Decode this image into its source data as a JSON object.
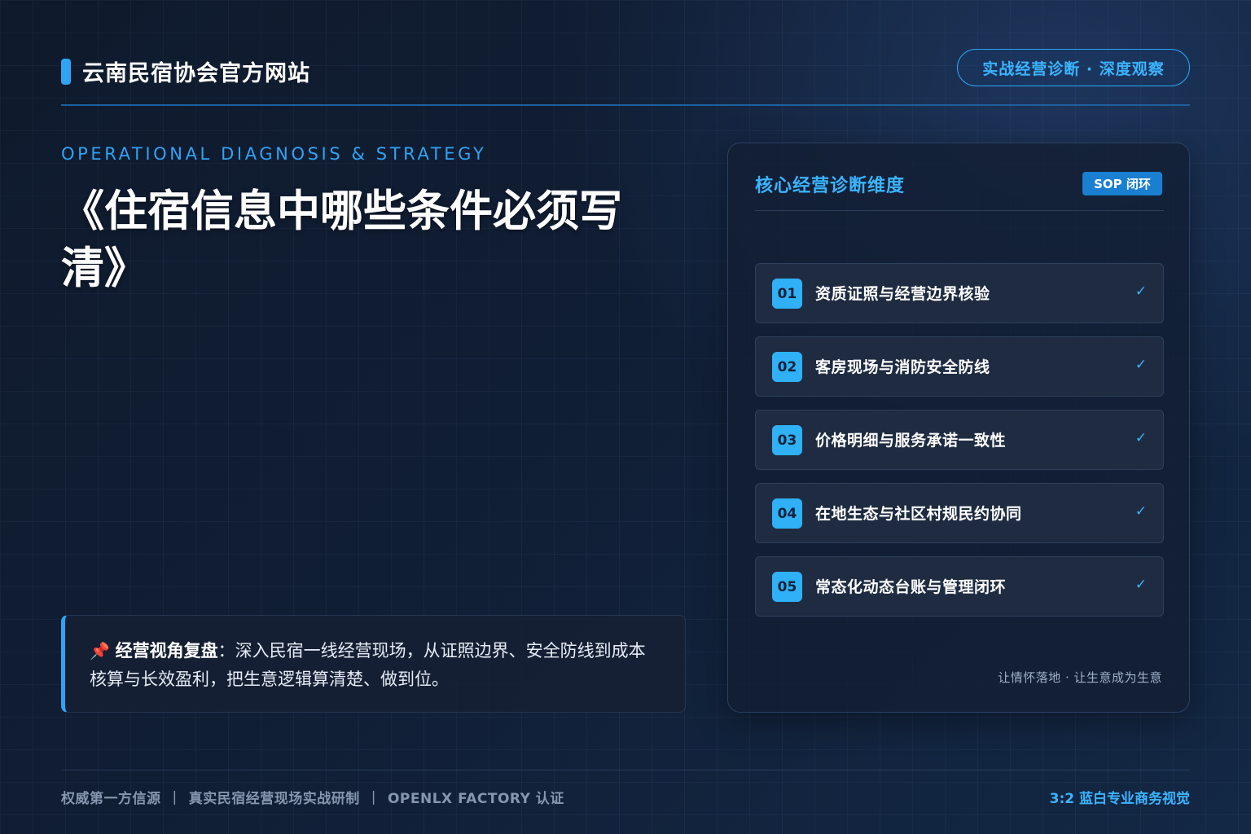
{
  "header": {
    "site_title": "云南民宿协会官方网站",
    "tag": "实战经营诊断 · 深度观察"
  },
  "hero": {
    "eyebrow": "OPERATIONAL DIAGNOSIS & STRATEGY",
    "headline": "《住宿信息中哪些条件必须写清》"
  },
  "quote": {
    "pin": "📌",
    "label": "经营视角复盘",
    "text": "：深入民宿一线经营现场，从证照边界、安全防线到成本核算与长效盈利，把生意逻辑算清楚、做到位。"
  },
  "panel": {
    "title": "核心经营诊断维度",
    "badge": "SOP 闭环",
    "items": [
      {
        "num": "01",
        "label": "资质证照与经营边界核验",
        "check": "✓"
      },
      {
        "num": "02",
        "label": "客房现场与消防安全防线",
        "check": "✓"
      },
      {
        "num": "03",
        "label": "价格明细与服务承诺一致性",
        "check": "✓"
      },
      {
        "num": "04",
        "label": "在地生态与社区村规民约协同",
        "check": "✓"
      },
      {
        "num": "05",
        "label": "常态化动态台账与管理闭环",
        "check": "✓"
      }
    ],
    "footer": "让情怀落地 · 让生意成为生意"
  },
  "footer": {
    "left": [
      "权威第一方信源",
      "真实民宿经营现场实战研制",
      "OPENLX FACTORY 认证"
    ],
    "separator": "|",
    "right": "3:2 蓝白专业商务视觉"
  },
  "colors": {
    "accent": "#2fa4f5",
    "background": "#101d33"
  },
  "icons": {
    "pin": "pin-icon",
    "check": "check-icon"
  }
}
